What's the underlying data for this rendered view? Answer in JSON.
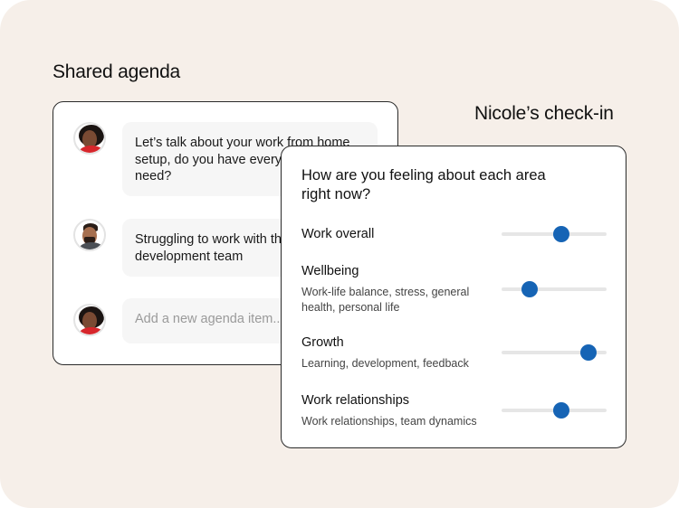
{
  "shared_agenda": {
    "title": "Shared agenda",
    "items": [
      {
        "text": "Let’s talk about your work from home setup, do you have everything you need?",
        "avatar": "woman-red-shirt-avatar"
      },
      {
        "text": "Struggling to work with the development team",
        "avatar": "man-beard-avatar"
      }
    ],
    "input": {
      "placeholder": "Add a new agenda item..."
    }
  },
  "checkin": {
    "title": "Nicole’s check-in",
    "question": "How are you feeling about each area right now?",
    "items": [
      {
        "title": "Work overall",
        "description": "",
        "level": 0.57
      },
      {
        "title": "Wellbeing",
        "description": "Work-life balance, stress, general health, personal life",
        "level": 0.27
      },
      {
        "title": "Growth",
        "description": "Learning, development, feedback",
        "level": 0.83
      },
      {
        "title": "Work relationships",
        "description": "Work relationships, team dynamics",
        "level": 0.57
      }
    ]
  },
  "colors": {
    "background": "#f6efe9",
    "accent": "#1664b5",
    "track": "#e6e6e6",
    "bubble": "#f6f6f6"
  }
}
